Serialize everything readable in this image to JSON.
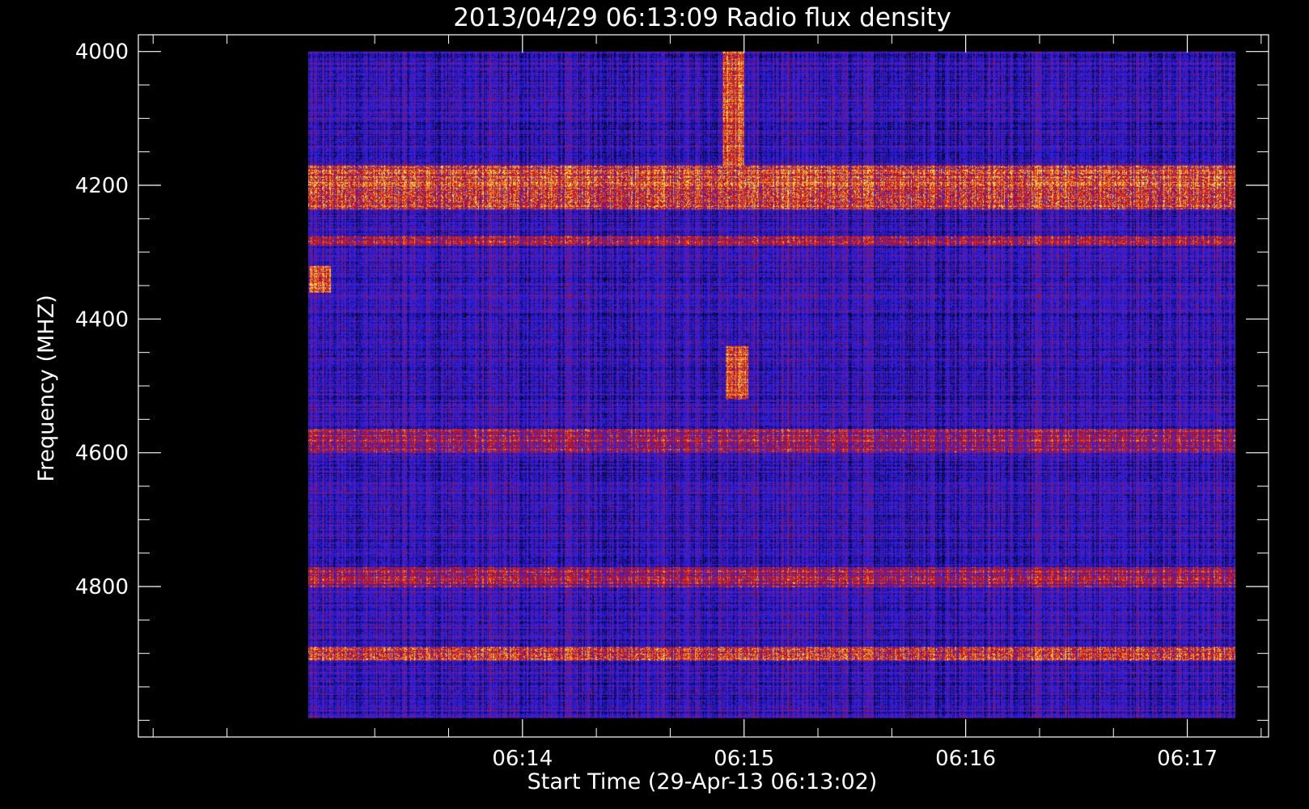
{
  "chart_data": {
    "type": "heatmap",
    "title": "2013/04/29 06:13:09 Radio flux density",
    "xlabel": "Start Time (29-Apr-13 06:13:02)",
    "ylabel": "Frequency (MHZ)",
    "x_range": [
      "06:12:16",
      "06:17:22"
    ],
    "x_data_range": [
      "06:13:02",
      "06:17:13"
    ],
    "x_ticks": [
      "06:14",
      "06:15",
      "06:16",
      "06:17"
    ],
    "x_minor_step_seconds": 20,
    "ylim": [
      3975,
      5025
    ],
    "y_data_range": [
      4000,
      4997
    ],
    "y_ticks": [
      4000,
      4200,
      4400,
      4600,
      4800
    ],
    "y_minor_step": 50,
    "y_inverted": true,
    "colormap": [
      "#000000",
      "#1a0a80",
      "#1e1ee6",
      "#3d1fd1",
      "#6a1a9a",
      "#b0101e",
      "#e02010",
      "#f07020",
      "#f0e060"
    ],
    "colorbar_shown": false,
    "features": [
      {
        "type": "horizontal_band",
        "freq_range": [
          4170,
          4235
        ],
        "intensity": "strong"
      },
      {
        "type": "horizontal_band",
        "freq_range": [
          4275,
          4290
        ],
        "intensity": "medium"
      },
      {
        "type": "horizontal_band",
        "freq_range": [
          4565,
          4600
        ],
        "intensity": "medium"
      },
      {
        "type": "horizontal_band",
        "freq_range": [
          4770,
          4800
        ],
        "intensity": "medium"
      },
      {
        "type": "horizontal_band",
        "freq_range": [
          4890,
          4910
        ],
        "intensity": "strong"
      },
      {
        "type": "burst",
        "time": "06:13:05",
        "freq_range": [
          4320,
          4360
        ],
        "intensity": "strong"
      },
      {
        "type": "burst",
        "time": "06:14:57",
        "freq_range": [
          4000,
          4170
        ],
        "intensity": "strong"
      },
      {
        "type": "burst",
        "time": "06:14:58",
        "freq_range": [
          4440,
          4520
        ],
        "intensity": "strong"
      }
    ]
  }
}
